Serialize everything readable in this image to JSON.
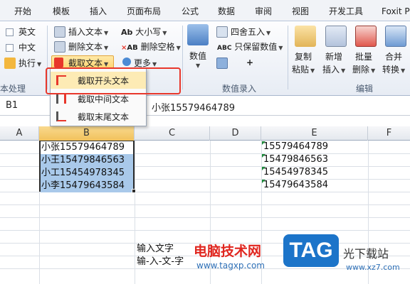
{
  "tabs": [
    "开始",
    "模板",
    "插入",
    "页面布局",
    "公式",
    "数据",
    "审阅",
    "视图",
    "开发工具",
    "Foxit P"
  ],
  "ribbon": {
    "text_group": {
      "check_en": "英文",
      "check_cn": "中文",
      "execute": "执行",
      "label": "本处理"
    },
    "insert_group": {
      "insert_text": "插入文本",
      "delete_text": "删除文本",
      "extract_text": "截取文本",
      "case": "大小写",
      "delete_space": "删除空格",
      "more": "更多"
    },
    "number_group": {
      "value_btn": "数值",
      "round": "四舍五入",
      "keep_value": "只保留数值",
      "plus": "+",
      "label": "数值录入"
    },
    "edit_group": {
      "copy_paste": [
        "复制",
        "粘贴"
      ],
      "new_insert": [
        "新增",
        "插入"
      ],
      "batch_delete": [
        "批量",
        "删除"
      ],
      "merge_convert": [
        "合并",
        "转换"
      ],
      "label": "编辑"
    }
  },
  "dropdown": {
    "items": [
      "截取开头文本",
      "截取中间文本",
      "截取末尾文本"
    ],
    "highlighted": 0
  },
  "formula_bar": {
    "name_box": "B1",
    "value": "小张15579464789"
  },
  "sheet": {
    "columns": [
      "A",
      "B",
      "C",
      "D",
      "E",
      "F"
    ],
    "selected_column": "B",
    "col_b": [
      "小张15579464789",
      "小王15479846563",
      "小工15454978345",
      "小李15479643584"
    ],
    "col_e": [
      "15579464789",
      "15479846563",
      "15454978345",
      "15479643584"
    ],
    "col_c_notes": [
      "输入文字",
      "输-入-文-字"
    ]
  },
  "watermark": {
    "tag": "TAG",
    "cn_site": "电脑技术网",
    "url": "www.tagxp.com",
    "cn_site2": "光下载站",
    "url2": "www.xz7.com"
  },
  "colors": {
    "selection": "#a9c9ea",
    "menu_highlight": "#fdebb5",
    "callout_red": "#e8372b",
    "accent_blue": "#1c74c9"
  }
}
